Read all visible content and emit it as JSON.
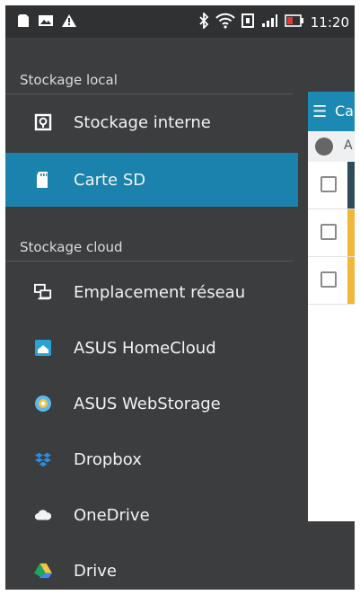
{
  "status_bar": {
    "time": "11:20"
  },
  "drawer": {
    "local_section": "Stockage local",
    "local_items": [
      {
        "label": "Stockage interne",
        "icon": "internal-storage-icon"
      },
      {
        "label": "Carte SD",
        "icon": "sd-card-icon",
        "selected": true
      }
    ],
    "cloud_section": "Stockage cloud",
    "cloud_items": [
      {
        "label": "Emplacement réseau",
        "icon": "network-location-icon"
      },
      {
        "label": "ASUS HomeCloud",
        "icon": "asus-homecloud-icon"
      },
      {
        "label": "ASUS WebStorage",
        "icon": "asus-webstorage-icon"
      },
      {
        "label": "Dropbox",
        "icon": "dropbox-icon"
      },
      {
        "label": "OneDrive",
        "icon": "onedrive-icon"
      },
      {
        "label": "Drive",
        "icon": "google-drive-icon"
      }
    ]
  },
  "background_app": {
    "title": "Ca",
    "path": "A"
  },
  "colors": {
    "drawer_bg": "#3b3d3f",
    "accent": "#1a82ad",
    "status_bar_bg": "#2f3133"
  }
}
